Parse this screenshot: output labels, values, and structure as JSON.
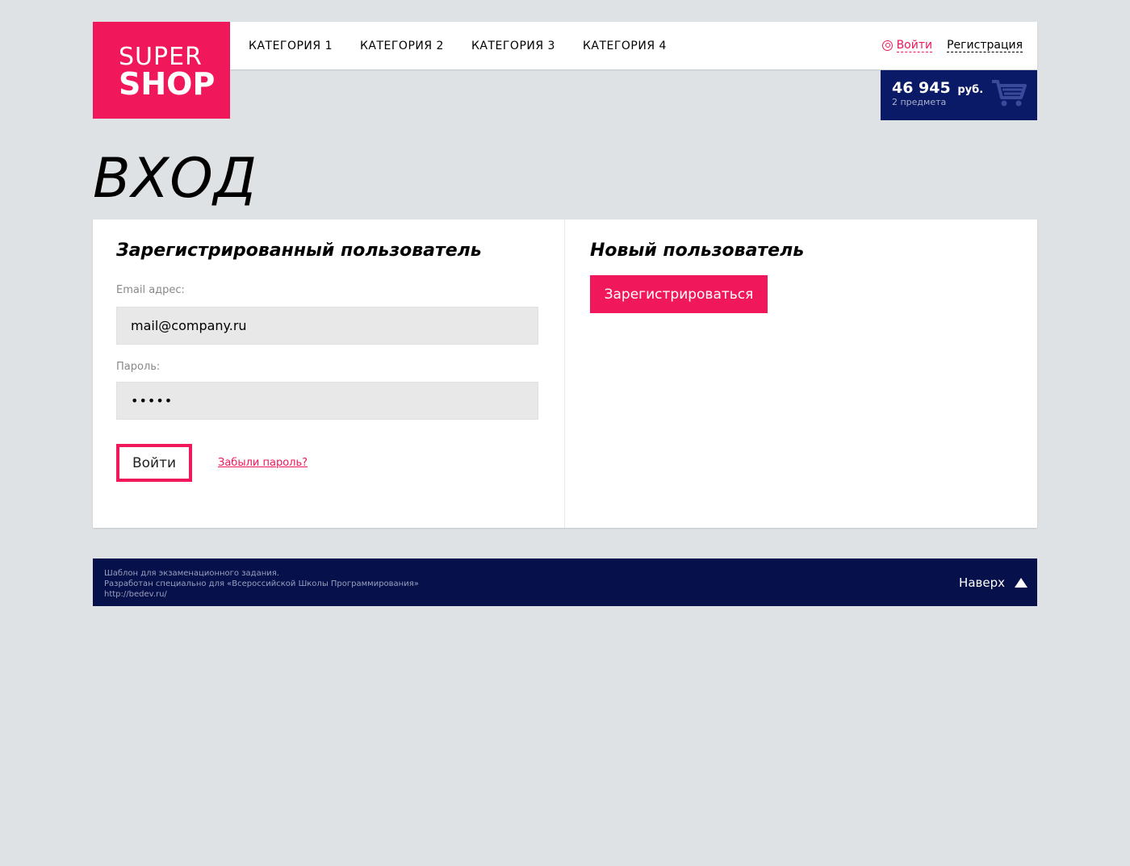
{
  "logo": {
    "line1": "SUPER",
    "line2": "SHOP"
  },
  "nav": {
    "items": [
      {
        "label": "КАТЕГОРИЯ 1"
      },
      {
        "label": "КАТЕГОРИЯ 2"
      },
      {
        "label": "КАТЕГОРИЯ 3"
      },
      {
        "label": "КАТЕГОРИЯ 4"
      }
    ]
  },
  "auth": {
    "login_label": "Войти",
    "register_label": "Регистрация"
  },
  "cart": {
    "sum": "46 945",
    "currency": "руб.",
    "count": "2 предмета"
  },
  "page": {
    "title": "ВХОД"
  },
  "login_form": {
    "title": "Зарегистрированный пользователь",
    "email_label": "Email адрес:",
    "email_value": "mail@company.ru",
    "password_label": "Пароль:",
    "password_value": "•••••",
    "submit_label": "Войти",
    "forgot_label": "Забыли пароль?"
  },
  "new_user": {
    "title": "Новый пользователь",
    "register_button": "Зарегистрироваться"
  },
  "footer": {
    "line1": "Шаблон для экзаменационного задания.",
    "line2": "Разработан специально для «Всероссийской Школы Программирования»",
    "line3": "http://bedev.ru/",
    "to_top": "Наверх"
  },
  "colors": {
    "accent": "#f0185a",
    "dark_blue": "#0b1a66",
    "footer_bg": "#06104a",
    "page_bg": "#dfe2e5"
  },
  "icons": {
    "user": "user-icon",
    "cart": "cart-icon",
    "arrow_up": "arrow-up-icon"
  }
}
